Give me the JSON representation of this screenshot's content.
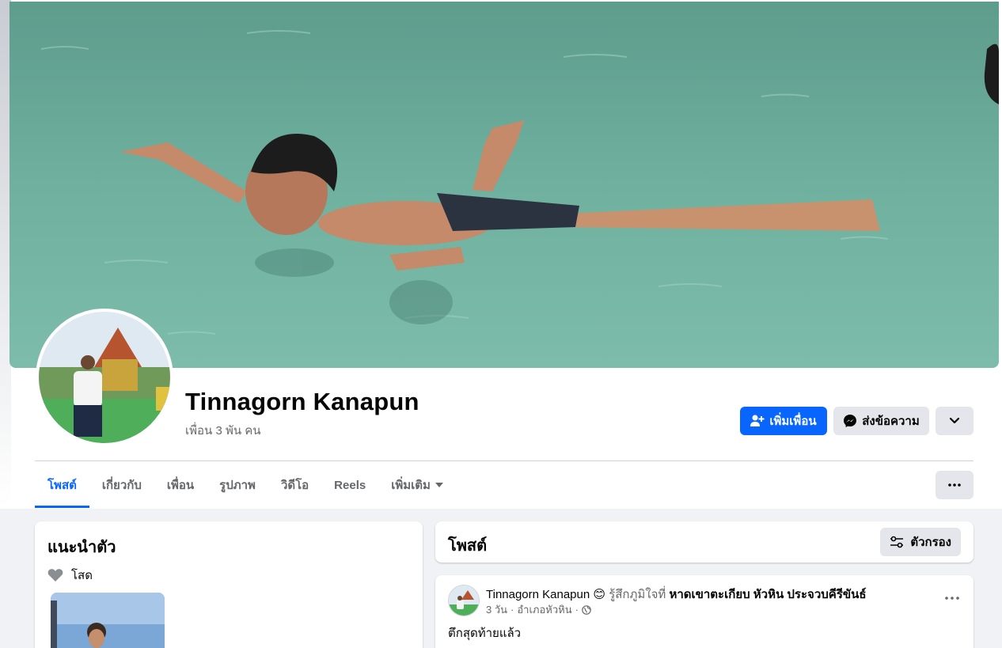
{
  "profile": {
    "name": "Tinnagorn Kanapun",
    "friends": "เพื่อน 3 พัน คน"
  },
  "actions": {
    "add_friend": "เพิ่มเพื่อน",
    "message": "ส่งข้อความ"
  },
  "tabs": [
    {
      "label": "โพสต์",
      "active": true
    },
    {
      "label": "เกี่ยวกับ",
      "active": false
    },
    {
      "label": "เพื่อน",
      "active": false
    },
    {
      "label": "รูปภาพ",
      "active": false
    },
    {
      "label": "วิดีโอ",
      "active": false
    },
    {
      "label": "Reels",
      "active": false
    },
    {
      "label": "เพิ่มเติม",
      "active": false
    }
  ],
  "intro": {
    "title": "แนะนำตัว",
    "status": "โสด"
  },
  "posts_section": {
    "title": "โพสต์",
    "filter_label": "ตัวกรอง"
  },
  "post": {
    "author": "Tinnagorn Kanapun",
    "emoji": "😊",
    "feeling_text": "รู้สึกภูมิใจที่",
    "place": "หาดเขาตะเกียบ หัวหิน ประจวบคีรีขันธ์",
    "time": "3 วัน",
    "location": "อำเภอหัวหิน",
    "text": "ตึกสุดท้ายแล้ว"
  },
  "icons": {
    "add_friend": "person-add-icon",
    "message": "messenger-icon",
    "more": "chevron-down-icon",
    "dots": "more-dots-icon",
    "heart": "heart-icon",
    "filter": "filter-sliders-icon",
    "globe": "globe-icon",
    "dropdown": "caret-down-icon"
  },
  "colors": {
    "accent": "#0866ff",
    "secondary_button": "#e4e6eb",
    "muted_text": "#65676b",
    "page_bg": "#f0f2f5"
  }
}
